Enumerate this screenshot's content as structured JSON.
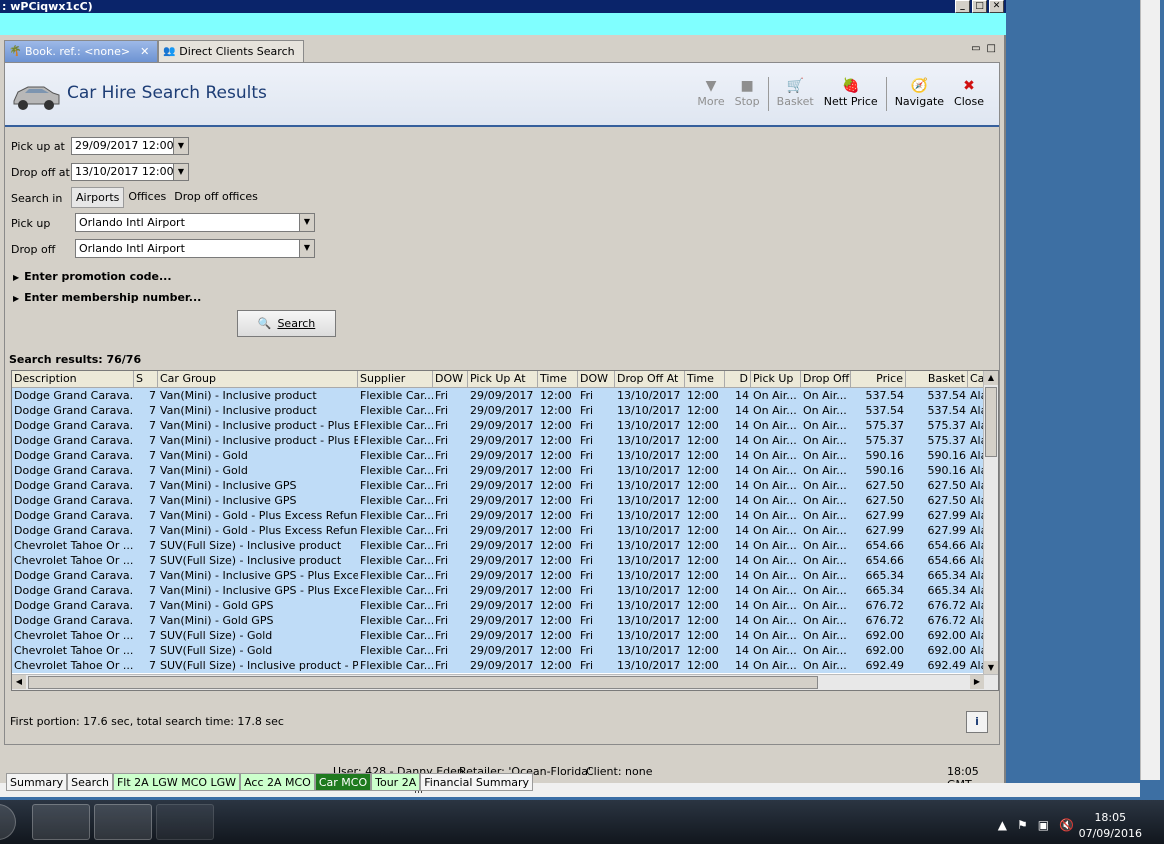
{
  "window": {
    "title": ": wPCiqwx1cC)"
  },
  "tabs": [
    {
      "label": "Book. ref.: <none>"
    },
    {
      "label": "Direct Clients Search"
    }
  ],
  "header": {
    "title": "Car Hire Search Results"
  },
  "toolbar": {
    "more": "More",
    "stop": "Stop",
    "basket": "Basket",
    "nett_price": "Nett Price",
    "navigate": "Navigate",
    "close": "Close"
  },
  "form": {
    "pickup_at_label": "Pick up at",
    "pickup_at_value": "29/09/2017 12:00",
    "dropoff_at_label": "Drop off at",
    "dropoff_at_value": "13/10/2017 12:00",
    "search_in_label": "Search in",
    "search_in_options": [
      "Airports",
      "Offices",
      "Drop off offices"
    ],
    "pickup_label": "Pick up",
    "pickup_value": "Orlando Intl Airport",
    "dropoff_label": "Drop off",
    "dropoff_value": "Orlando Intl Airport",
    "promo_label": "Enter promotion code...",
    "membership_label": "Enter membership number...",
    "search_button": "Search"
  },
  "results": {
    "label": "Search results: 76/76",
    "columns": [
      "Description",
      "S",
      "Car Group",
      "Supplier",
      "DOW",
      "Pick Up At",
      "Time",
      "DOW",
      "Drop Off At",
      "Time",
      "D",
      "Pick Up",
      "Drop Off",
      "Price",
      "Basket",
      "Ca"
    ],
    "rows": [
      [
        "Dodge Grand Carava...",
        "7",
        "Van(Mini) - Inclusive product",
        "Flexible Car...",
        "Fri",
        "29/09/2017",
        "12:00",
        "Fri",
        "13/10/2017",
        "12:00",
        "14",
        "On Air...",
        "On Air...",
        "537.54",
        "537.54",
        "Ala"
      ],
      [
        "Dodge Grand Carava...",
        "7",
        "Van(Mini) - Inclusive product",
        "Flexible Car...",
        "Fri",
        "29/09/2017",
        "12:00",
        "Fri",
        "13/10/2017",
        "12:00",
        "14",
        "On Air...",
        "On Air...",
        "537.54",
        "537.54",
        "Ala"
      ],
      [
        "Dodge Grand Carava...",
        "7",
        "Van(Mini) - Inclusive product - Plus Ex...",
        "Flexible Car...",
        "Fri",
        "29/09/2017",
        "12:00",
        "Fri",
        "13/10/2017",
        "12:00",
        "14",
        "On Air...",
        "On Air...",
        "575.37",
        "575.37",
        "Ala"
      ],
      [
        "Dodge Grand Carava...",
        "7",
        "Van(Mini) - Inclusive product - Plus Ex...",
        "Flexible Car...",
        "Fri",
        "29/09/2017",
        "12:00",
        "Fri",
        "13/10/2017",
        "12:00",
        "14",
        "On Air...",
        "On Air...",
        "575.37",
        "575.37",
        "Ala"
      ],
      [
        "Dodge Grand Carava...",
        "7",
        "Van(Mini) - Gold",
        "Flexible Car...",
        "Fri",
        "29/09/2017",
        "12:00",
        "Fri",
        "13/10/2017",
        "12:00",
        "14",
        "On Air...",
        "On Air...",
        "590.16",
        "590.16",
        "Ala"
      ],
      [
        "Dodge Grand Carava...",
        "7",
        "Van(Mini) - Gold",
        "Flexible Car...",
        "Fri",
        "29/09/2017",
        "12:00",
        "Fri",
        "13/10/2017",
        "12:00",
        "14",
        "On Air...",
        "On Air...",
        "590.16",
        "590.16",
        "Ala"
      ],
      [
        "Dodge Grand Carava...",
        "7",
        "Van(Mini) - Inclusive GPS",
        "Flexible Car...",
        "Fri",
        "29/09/2017",
        "12:00",
        "Fri",
        "13/10/2017",
        "12:00",
        "14",
        "On Air...",
        "On Air...",
        "627.50",
        "627.50",
        "Ala"
      ],
      [
        "Dodge Grand Carava...",
        "7",
        "Van(Mini) - Inclusive GPS",
        "Flexible Car...",
        "Fri",
        "29/09/2017",
        "12:00",
        "Fri",
        "13/10/2017",
        "12:00",
        "14",
        "On Air...",
        "On Air...",
        "627.50",
        "627.50",
        "Ala"
      ],
      [
        "Dodge Grand Carava...",
        "7",
        "Van(Mini) - Gold - Plus Excess Refund",
        "Flexible Car...",
        "Fri",
        "29/09/2017",
        "12:00",
        "Fri",
        "13/10/2017",
        "12:00",
        "14",
        "On Air...",
        "On Air...",
        "627.99",
        "627.99",
        "Ala"
      ],
      [
        "Dodge Grand Carava...",
        "7",
        "Van(Mini) - Gold - Plus Excess Refund",
        "Flexible Car...",
        "Fri",
        "29/09/2017",
        "12:00",
        "Fri",
        "13/10/2017",
        "12:00",
        "14",
        "On Air...",
        "On Air...",
        "627.99",
        "627.99",
        "Ala"
      ],
      [
        "Chevrolet Tahoe Or ...",
        "7",
        "SUV(Full Size) - Inclusive product",
        "Flexible Car...",
        "Fri",
        "29/09/2017",
        "12:00",
        "Fri",
        "13/10/2017",
        "12:00",
        "14",
        "On Air...",
        "On Air...",
        "654.66",
        "654.66",
        "Ala"
      ],
      [
        "Chevrolet Tahoe Or ...",
        "7",
        "SUV(Full Size) - Inclusive product",
        "Flexible Car...",
        "Fri",
        "29/09/2017",
        "12:00",
        "Fri",
        "13/10/2017",
        "12:00",
        "14",
        "On Air...",
        "On Air...",
        "654.66",
        "654.66",
        "Ala"
      ],
      [
        "Dodge Grand Carava...",
        "7",
        "Van(Mini) - Inclusive GPS - Plus Exces...",
        "Flexible Car...",
        "Fri",
        "29/09/2017",
        "12:00",
        "Fri",
        "13/10/2017",
        "12:00",
        "14",
        "On Air...",
        "On Air...",
        "665.34",
        "665.34",
        "Ala"
      ],
      [
        "Dodge Grand Carava...",
        "7",
        "Van(Mini) - Inclusive GPS - Plus Exces...",
        "Flexible Car...",
        "Fri",
        "29/09/2017",
        "12:00",
        "Fri",
        "13/10/2017",
        "12:00",
        "14",
        "On Air...",
        "On Air...",
        "665.34",
        "665.34",
        "Ala"
      ],
      [
        "Dodge Grand Carava...",
        "7",
        "Van(Mini) - Gold GPS",
        "Flexible Car...",
        "Fri",
        "29/09/2017",
        "12:00",
        "Fri",
        "13/10/2017",
        "12:00",
        "14",
        "On Air...",
        "On Air...",
        "676.72",
        "676.72",
        "Ala"
      ],
      [
        "Dodge Grand Carava...",
        "7",
        "Van(Mini) - Gold GPS",
        "Flexible Car...",
        "Fri",
        "29/09/2017",
        "12:00",
        "Fri",
        "13/10/2017",
        "12:00",
        "14",
        "On Air...",
        "On Air...",
        "676.72",
        "676.72",
        "Ala"
      ],
      [
        "Chevrolet Tahoe Or ...",
        "7",
        "SUV(Full Size) - Gold",
        "Flexible Car...",
        "Fri",
        "29/09/2017",
        "12:00",
        "Fri",
        "13/10/2017",
        "12:00",
        "14",
        "On Air...",
        "On Air...",
        "692.00",
        "692.00",
        "Ala"
      ],
      [
        "Chevrolet Tahoe Or ...",
        "7",
        "SUV(Full Size) - Gold",
        "Flexible Car...",
        "Fri",
        "29/09/2017",
        "12:00",
        "Fri",
        "13/10/2017",
        "12:00",
        "14",
        "On Air...",
        "On Air...",
        "692.00",
        "692.00",
        "Ala"
      ],
      [
        "Chevrolet Tahoe Or ...",
        "7",
        "SUV(Full Size) - Inclusive product - Plu...",
        "Flexible Car...",
        "Fri",
        "29/09/2017",
        "12:00",
        "Fri",
        "13/10/2017",
        "12:00",
        "14",
        "On Air...",
        "On Air...",
        "692.49",
        "692.49",
        "Ala"
      ]
    ]
  },
  "timing": "First portion: 17.6 sec, total search time: 17.8 sec",
  "bottom_tabs": [
    "Summary",
    "Search",
    "Flt 2A LGW MCO LGW",
    "Acc 2A MCO",
    "Car MCO",
    "Tour 2A",
    "Financial Summary"
  ],
  "status": {
    "user": "User: 428 - Danny Eden",
    "retailer": "Retailer: 'Ocean-Florida'",
    "client": "Client: none",
    "time": "18:05 GMT"
  },
  "taskbar": {
    "time": "18:05",
    "date": "07/09/2016"
  },
  "colors": {
    "row_bg": "#bfdcf7",
    "header_title": "#1d3d75",
    "active_tab": "#1f7a1f",
    "title_bar": "#0a246a"
  }
}
